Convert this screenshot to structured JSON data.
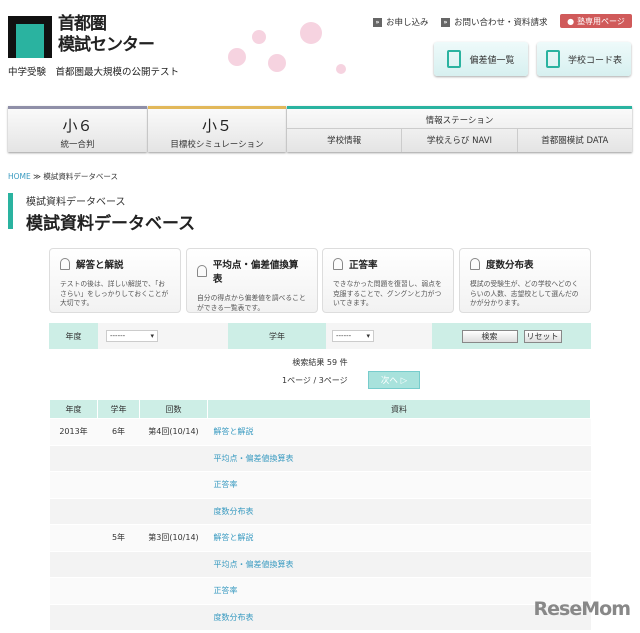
{
  "header": {
    "logo_line1": "首都圏",
    "logo_line2": "模試センター",
    "tagline": "中学受験　首都圏最大規模の公開テスト",
    "links": [
      "お申し込み",
      "お問い合わせ・資料請求"
    ],
    "juku_label": "塾専用ページ",
    "buttons": [
      "偏差値一覧",
      "学校コード表"
    ]
  },
  "nav": {
    "g6_big": "小６",
    "g6_sm": "統一合判",
    "g5_big": "小５",
    "g5_sm": "目標校シミュレーション",
    "info": "情報ステーション",
    "sub": [
      "学校情報",
      "学校えらび NAVI",
      "首都圏模試 DATA"
    ],
    "colors": {
      "g6": "#8f8fa8",
      "g5": "#e2b85a",
      "info": "#2ab3a0"
    }
  },
  "breadcrumb": {
    "home": "HOME",
    "sep": "≫",
    "current": "模試資料データベース"
  },
  "heading": {
    "small": "模試資料データベース",
    "large": "模試資料データベース"
  },
  "cards": [
    {
      "title": "解答と解説",
      "desc": "テストの後は、詳しい解説で、「おさらい」をしっかりしておくことが大切です。"
    },
    {
      "title": "平均点・偏差値換算表",
      "desc": "自分の得点から偏差値を調べることができる一覧表です。"
    },
    {
      "title": "正答率",
      "desc": "できなかった問題を復習し、弱点を克服することで、グングンと力がついてきます。"
    },
    {
      "title": "度数分布表",
      "desc": "模試の受験生が、どの学校へどのくらいの人数、志望校として選んだのかが分かります。"
    }
  ],
  "search": {
    "year_label": "年度",
    "year_value": "------",
    "grade_label": "学年",
    "grade_value": "------",
    "search_btn": "検索",
    "reset_btn": "リセット"
  },
  "results": {
    "count": "検索結果 59 件",
    "pages": "1ページ / 3ページ",
    "next": "次へ ▷"
  },
  "table": {
    "headers": [
      "年度",
      "学年",
      "回数",
      "資料"
    ],
    "rows": [
      [
        "2013年",
        "6年",
        "第4回(10/14)",
        "解答と解説"
      ],
      [
        "",
        "",
        "",
        "平均点・偏差値換算表"
      ],
      [
        "",
        "",
        "",
        "正答率"
      ],
      [
        "",
        "",
        "",
        "度数分布表"
      ],
      [
        "",
        "5年",
        "第3回(10/14)",
        "解答と解説"
      ],
      [
        "",
        "",
        "",
        "平均点・偏差値換算表"
      ],
      [
        "",
        "",
        "",
        "正答率"
      ],
      [
        "",
        "",
        "",
        "度数分布表"
      ]
    ]
  },
  "watermark": "ReseMom"
}
